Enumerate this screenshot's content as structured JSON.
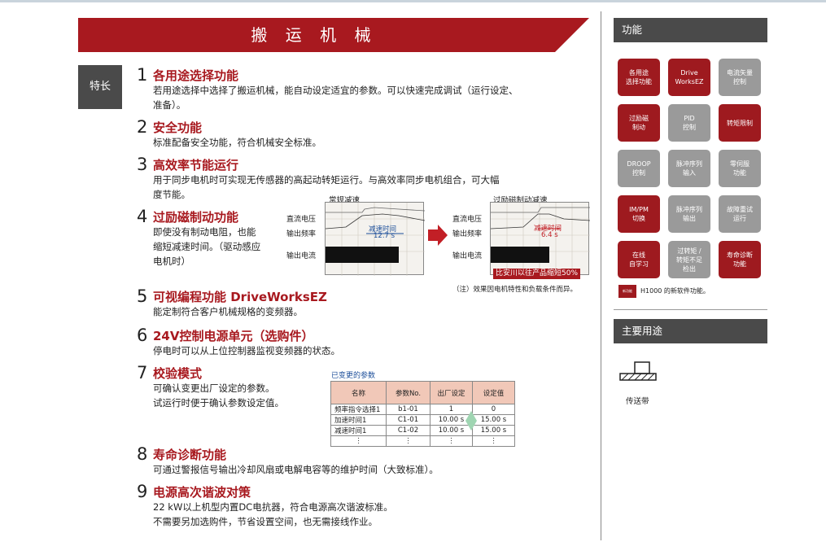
{
  "title": "搬 运 机 械",
  "feature_tag": "特长",
  "features": [
    {
      "num": "1",
      "heading": "各用途选择功能",
      "desc": [
        "若用途选择中选择了搬运机械，能自动设定适宜的参数。可以快速完成调试（运行设定、",
        "准备）。"
      ]
    },
    {
      "num": "2",
      "heading": "安全功能",
      "desc": [
        "标准配备安全功能，符合机械安全标准。"
      ]
    },
    {
      "num": "3",
      "heading": "高效率节能运行",
      "desc": [
        "用于同步电机时可实现无传感器的高起动转矩运行。与高效率同步电机组合，可大幅",
        "度节能。"
      ]
    },
    {
      "num": "4",
      "heading": "过励磁制动功能",
      "desc": [
        "即使没有制动电阻，也能",
        "缩短减速时间。（驱动感应",
        "电机时）"
      ]
    },
    {
      "num": "5",
      "heading": "可视编程功能 DriveWorksEZ",
      "desc": [
        "能定制符合客户机械规格的变频器。"
      ]
    },
    {
      "num": "6",
      "heading": "24V控制电源单元（选购件）",
      "desc": [
        "停电时可以从上位控制器监视变频器的状态。"
      ]
    },
    {
      "num": "7",
      "heading": "校验模式",
      "desc": [
        "可确认变更出厂设定的参数。",
        "试运行时便于确认参数设定值。"
      ]
    },
    {
      "num": "8",
      "heading": "寿命诊断功能",
      "desc": [
        "可通过警报信号输出冷却风扇或电解电容等的维护时间（大致标准）。"
      ]
    },
    {
      "num": "9",
      "heading": "电源高次谐波对策",
      "desc": [
        "22 kW以上机型内置DC电抗器，符合电源高次谐波标准。",
        "不需要另加选购件，节省设置空间，也无需接线作业。"
      ]
    }
  ],
  "graphs": {
    "left_title": "常规减速",
    "right_title": "过励磁制动减速",
    "labels": [
      "直流电压",
      "输出频率",
      "输出电流"
    ],
    "left_value_label": "减速时间",
    "left_value": "12.7 s",
    "right_value_label": "减速时间",
    "right_value": "6.4 s",
    "compare_note": "比安川以往产品缩短50%",
    "footnote": "（注）效果因电机特性和负载条件而异。"
  },
  "param_table": {
    "title": "已变更的参数",
    "headers": [
      "名称",
      "参数No.",
      "出厂设定",
      "设定值"
    ],
    "rows": [
      [
        "频率指令选择1",
        "b1-01",
        "1",
        "0"
      ],
      [
        "加速时间1",
        "C1-01",
        "10.00 s",
        "15.00 s"
      ],
      [
        "减速时间1",
        "C1-02",
        "10.00 s",
        "15.00 s"
      ]
    ],
    "ellipsis": "⋮"
  },
  "sidebar": {
    "functions_title": "功能",
    "buttons": [
      {
        "label": "各用途\n选择功能",
        "active": true
      },
      {
        "label": "Drive\nWorksEZ",
        "active": true
      },
      {
        "label": "电流矢量\n控制",
        "active": false
      },
      {
        "label": "过励磁\n制动",
        "active": true
      },
      {
        "label": "PID\n控制",
        "active": false
      },
      {
        "label": "转矩限制",
        "active": true
      },
      {
        "label": "DROOP\n控制",
        "active": false
      },
      {
        "label": "脉冲序列\n输入",
        "active": false
      },
      {
        "label": "零伺服\n功能",
        "active": false
      },
      {
        "label": "IM/PM\n切换",
        "active": true
      },
      {
        "label": "脉冲序列\n输出",
        "active": false
      },
      {
        "label": "故障重试\n运行",
        "active": false
      },
      {
        "label": "在线\n自学习",
        "active": true
      },
      {
        "label": "过转矩 /\n转矩不足\n检出",
        "active": false
      },
      {
        "label": "寿命诊断\n功能",
        "active": true
      }
    ],
    "legend_box": "新功能",
    "legend_text": "H1000 的新软件功能。",
    "uses_title": "主要用途",
    "use_item": "传送带"
  },
  "colors": {
    "brand_red": "#a8191f",
    "dark_gray": "#4a4a4a",
    "inactive_gray": "#9a9a9a"
  }
}
